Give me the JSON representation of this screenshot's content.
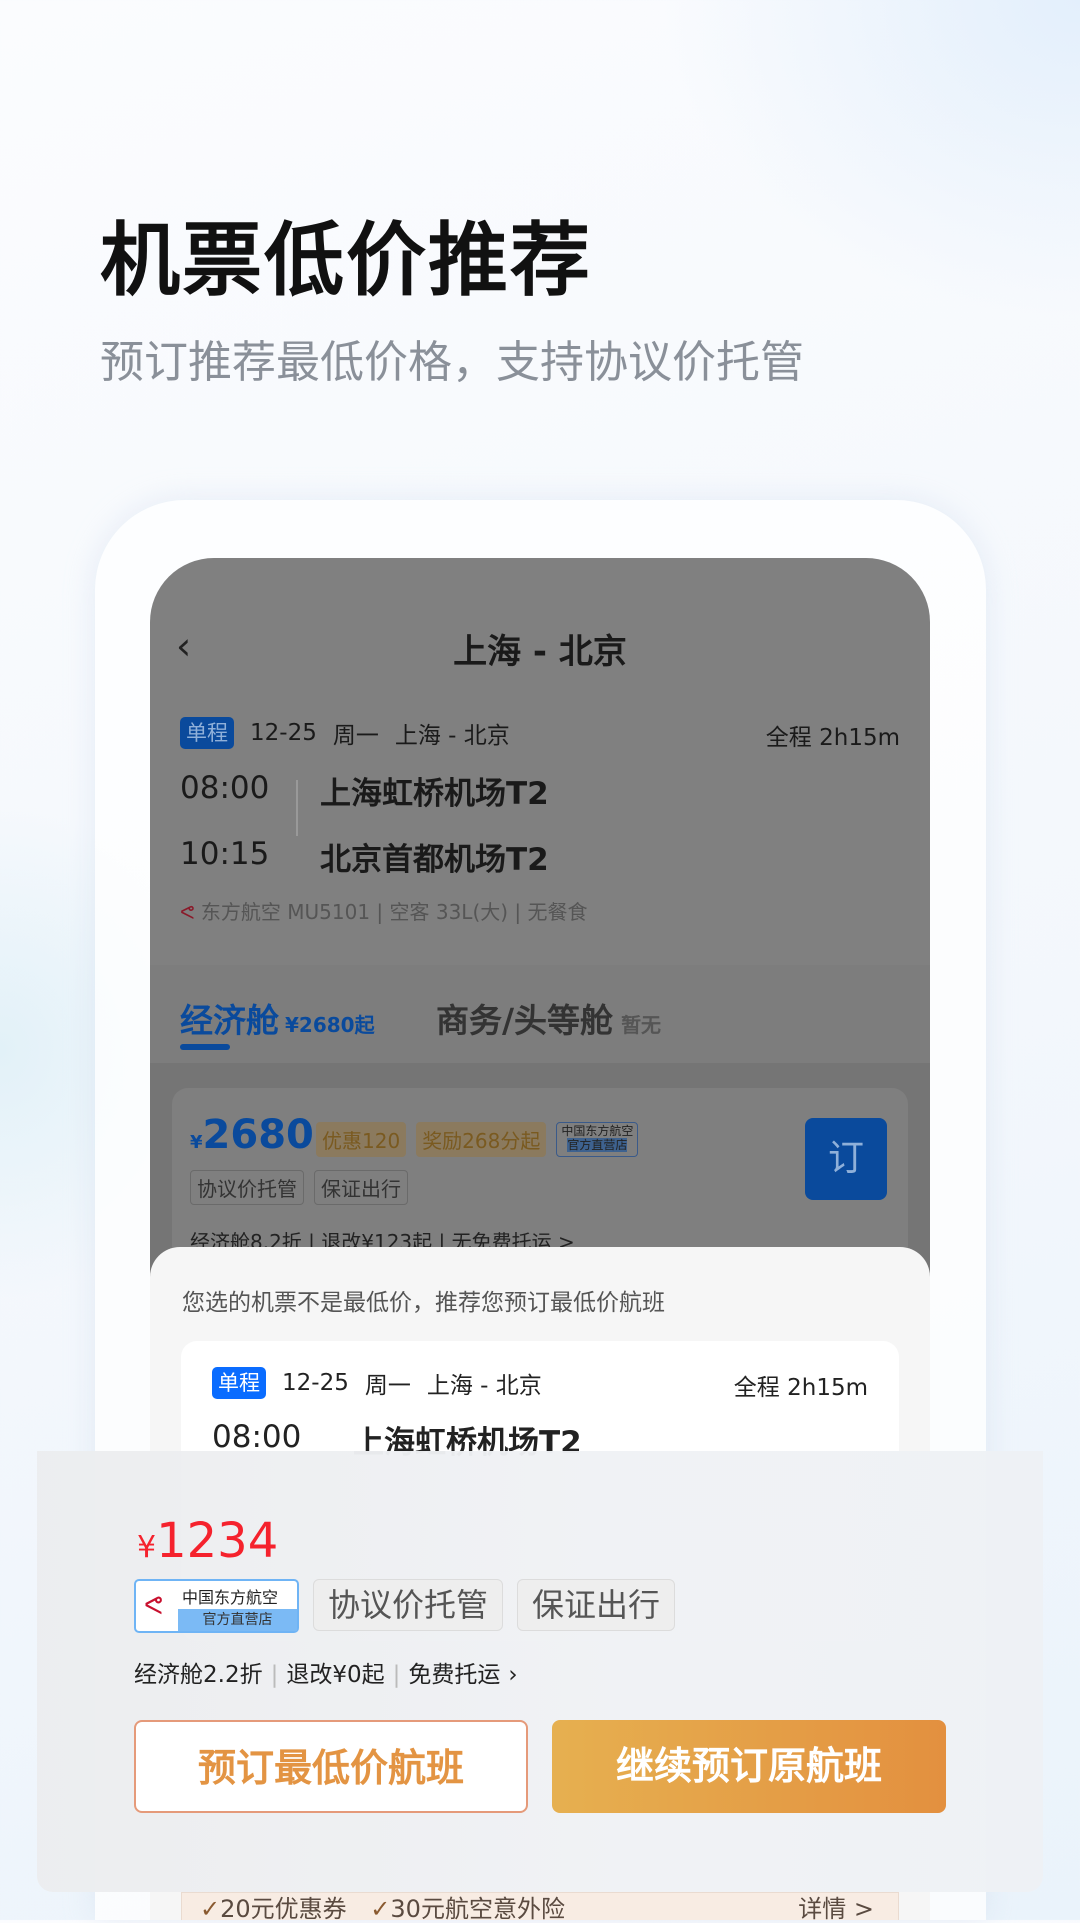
{
  "hero": {
    "title": "机票低价推荐",
    "subtitle": "预订推荐最低价格，支持协议价托管"
  },
  "screen": {
    "nav_title": "上海 - 北京",
    "trip": {
      "type": "单程",
      "date": "12-25",
      "weekday": "周一",
      "route": "上海 - 北京",
      "duration": "全程 2h15m",
      "dep_time": "08:00",
      "dep_airport": "上海虹桥机场T2",
      "arr_time": "10:15",
      "arr_airport": "北京首都机场T2",
      "flight_info": "东方航空 MU5101 | 空客 33L(大) | 无餐食"
    },
    "tabs": [
      {
        "label": "经济舱",
        "sub": "¥2680起"
      },
      {
        "label": "商务/头等舱",
        "sub": "暂无"
      }
    ],
    "fare": {
      "currency": "¥",
      "price": "2680",
      "promo": "优惠120",
      "reward": "奖励268分起",
      "airline_badge": "中国东方航空",
      "airline_badge_sub": "官方直营店",
      "tags": [
        "协议价托管",
        "保证出行"
      ],
      "info": "经济舱8.2折 | 退改¥123起 | 无免费托运 >",
      "book": "订"
    }
  },
  "sheet": {
    "notice": "您选的机票不是最低价，推荐您预订最低价航班",
    "trip": {
      "type": "单程",
      "date": "12-25",
      "weekday": "周一",
      "route": "上海 - 北京",
      "duration": "全程 2h15m",
      "dep_time": "08:00",
      "dep_airport": "上海虹桥机场T2"
    }
  },
  "panel": {
    "currency": "¥",
    "price": "1234",
    "airline_badge": "中国东方航空",
    "airline_badge_sub": "官方直营店",
    "tags": [
      "协议价托管",
      "保证出行"
    ],
    "info": [
      "经济舱2.2折",
      "退改¥0起",
      "免费托运"
    ],
    "btn_lowest": "预订最低价航班",
    "btn_continue": "继续预订原航班"
  },
  "strip": {
    "items": [
      "20元优惠券",
      "30元航空意外险"
    ],
    "detail": "详情 >"
  },
  "colors": {
    "accent_blue": "#0a6cff",
    "price_red": "#f5222d",
    "orange": "#e39443"
  }
}
